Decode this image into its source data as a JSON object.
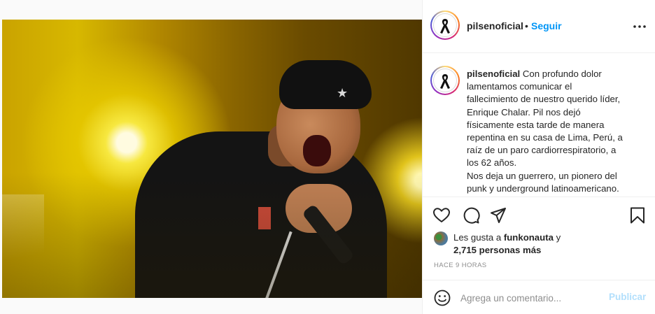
{
  "photo": {
    "alt_icon": "photo-of-singer",
    "accent_colors": [
      "#d7b800",
      "#141414"
    ]
  },
  "header": {
    "username": "pilsenoficial",
    "separator": "•",
    "follow_label": "Seguir",
    "more_icon": "more-horizontal-icon"
  },
  "caption": {
    "username": "pilsenoficial",
    "text_lines": [
      "Con profundo dolor",
      "lamentamos comunicar el",
      "fallecimiento de nuestro querido líder,",
      "Enrique Chalar. Pil nos dejó",
      "físicamente esta tarde de manera",
      "repentina en su casa de Lima, Perú, a",
      "raíz de un paro cardiorrespiratorio, a",
      "los 62 años.",
      "Nos deja un guerrero, un pionero del",
      "punk y underground latinoamericano."
    ]
  },
  "actions": {
    "like_icon": "heart-icon",
    "comment_icon": "comment-icon",
    "share_icon": "send-icon",
    "save_icon": "bookmark-icon"
  },
  "likes": {
    "prefix": "Les gusta a",
    "user": "funkonauta",
    "suffix": "y",
    "count": "2,715 personas más"
  },
  "time_ago": "HACE 9 HORAS",
  "comment": {
    "placeholder": "Agrega un comentario...",
    "publish_label": "Publicar",
    "emoji_icon": "smiley-icon"
  },
  "colors": {
    "link_blue": "#0095f6",
    "publish_disabled": "#b2dffc",
    "muted": "#8e8e8e",
    "border": "#efefef"
  }
}
